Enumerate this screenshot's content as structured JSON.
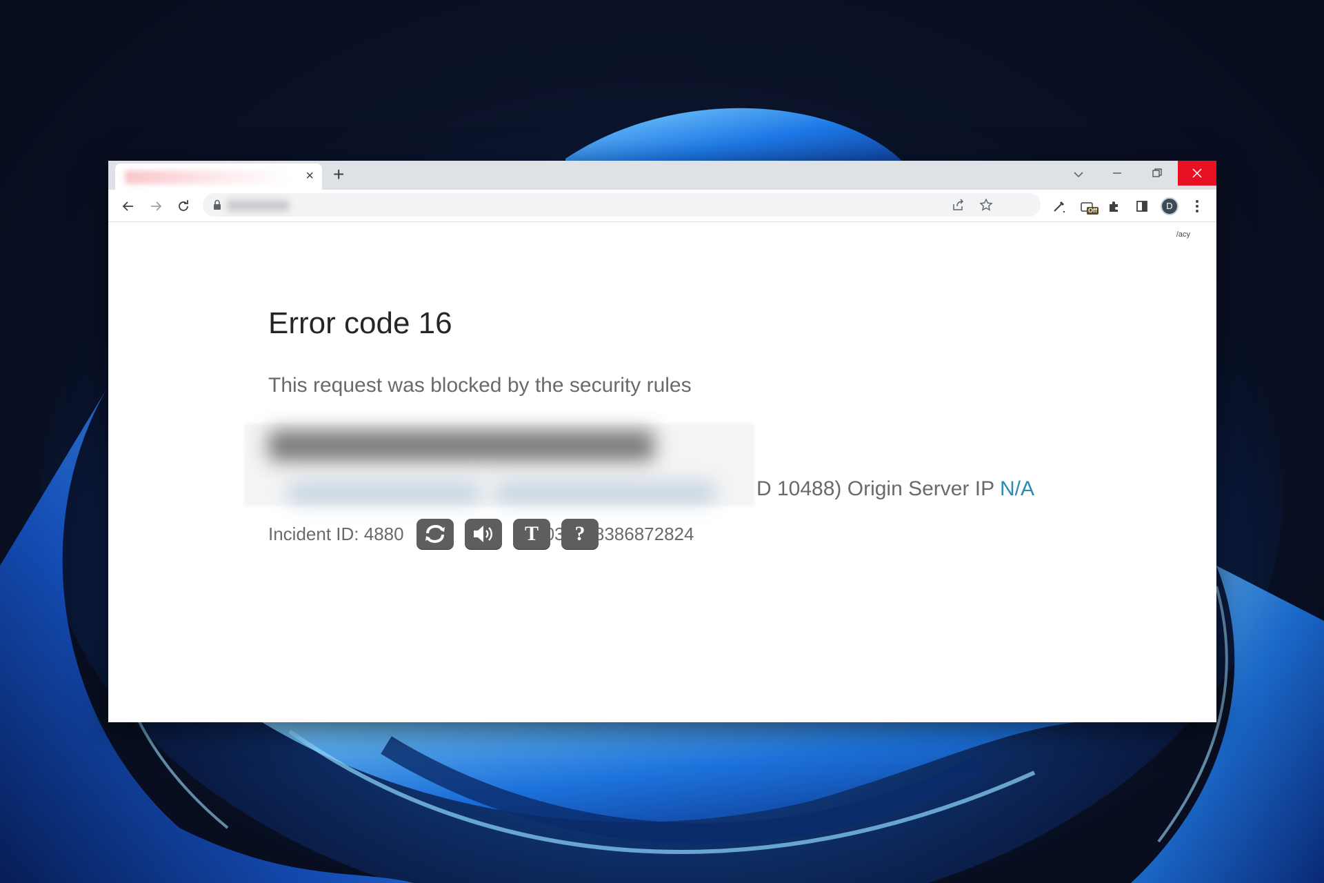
{
  "browser": {
    "tab": {
      "close_glyph": "×"
    },
    "new_tab_glyph": "+",
    "toolbar": {
      "avatar_letter": "D",
      "extension_badge": "Off"
    }
  },
  "page": {
    "privacy_link": "/acy",
    "error_title": "Error code 16",
    "error_subtitle": "This request was blocked by the security rules",
    "server_info_visible": "D 10488)  Origin Server IP ",
    "origin_ip_value": "N/A",
    "incident_prefix": "Incident ID: 4880",
    "incident_suffix": "031048386872824",
    "captcha_buttons": {
      "refresh_icon": "refresh-icon",
      "audio_icon": "speaker-icon",
      "text_label": "T",
      "help_label": "?"
    }
  },
  "colors": {
    "close_button": "#e81123",
    "link": "#2a8ab2",
    "captcha_button": "#5e5e5e"
  }
}
